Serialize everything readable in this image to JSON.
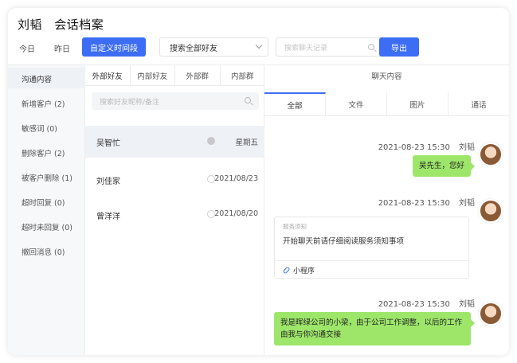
{
  "header": {
    "user_name": "刘韬",
    "page_title": "会话档案"
  },
  "toolbar": {
    "today": "今日",
    "yesterday": "昨日",
    "custom_range": "自定义时间段",
    "friend_select": "搜索全部好友",
    "search_placeholder": "搜索聊天记录",
    "export": "导出"
  },
  "sidebar": {
    "items": [
      {
        "label": "沟通内容"
      },
      {
        "label": "新增客户 (2)"
      },
      {
        "label": "敏感词 (0)"
      },
      {
        "label": "删除客户 (2)"
      },
      {
        "label": "被客户删除 (1)"
      },
      {
        "label": "超时回复 (0)"
      },
      {
        "label": "超时未回复 (0)"
      },
      {
        "label": "撤回消息 (0)"
      }
    ]
  },
  "contacts_panel": {
    "tabs": [
      "外部好友",
      "内部好友",
      "外部群",
      "内部群"
    ],
    "search_placeholder": "搜索好友昵称/备注",
    "contacts": [
      {
        "name": "吴智忙",
        "date": "星期五"
      },
      {
        "name": "刘佳家",
        "date": "2021/08/23"
      },
      {
        "name": "曾洋洋",
        "date": "2021/08/20"
      }
    ]
  },
  "chat_panel": {
    "title": "聊天内容",
    "tabs": [
      "全部",
      "文件",
      "图片",
      "通话"
    ],
    "messages": [
      {
        "time": "2021-08-23 15:30",
        "sender": "刘韬",
        "text": "吴先生，您好"
      },
      {
        "time": "2021-08-23 15:30",
        "sender": "刘韬",
        "card_tag": "服务须知",
        "card_text": "开始聊天前请仔细阅读服务须知事项",
        "card_link": "小程序"
      },
      {
        "time": "2021-08-23 15:30",
        "sender": "刘韬",
        "text": "我是晖绿公司的小梁，由于公司工作调整，以后的工作由我与你沟通交接"
      }
    ]
  },
  "colors": {
    "accent": "#3d6df5",
    "bubble": "#9de66a"
  }
}
